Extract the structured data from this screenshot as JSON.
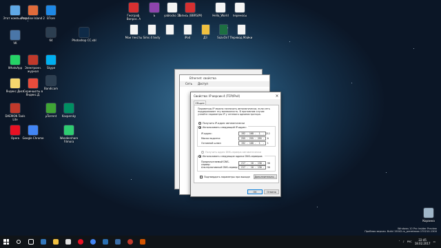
{
  "colors": {
    "accent": "#0078d7",
    "taskbar": "#101418"
  },
  "desktop_icons": [
    {
      "id": "this-pc",
      "label": "Этот компьютер",
      "icon": "computer-icon",
      "color": "#5fa8e6"
    },
    {
      "id": "paradise-island",
      "label": "Paradise Island 2",
      "icon": "game-icon",
      "color": "#e06b3b"
    },
    {
      "id": "bitrix",
      "label": "B7ore",
      "icon": "app-icon",
      "color": "#1e88e5"
    },
    {
      "id": "vk",
      "label": "VK",
      "icon": "vk-icon",
      "color": "#4a76a8"
    },
    {
      "id": "app64",
      "label": "64",
      "icon": "app-64-icon",
      "color": "#2c3e50"
    },
    {
      "id": "photoshop",
      "label": "Photoshop CC.xbl",
      "icon": "photoshop-icon",
      "color": "#0e2a47"
    },
    {
      "id": "whatsapp",
      "label": "WhatsApp",
      "icon": "whatsapp-icon",
      "color": "#25d366"
    },
    {
      "id": "electronic-journal",
      "label": "Электронн. журнал",
      "icon": "journal-icon",
      "color": "#c0392b"
    },
    {
      "id": "skype",
      "label": "Skype",
      "icon": "skype-icon",
      "color": "#00aff0"
    },
    {
      "id": "yandex-disk",
      "label": "Яндекс.Диск",
      "icon": "yandex-disk-icon",
      "color": "#f5d76e"
    },
    {
      "id": "screenshots",
      "label": "Скриншоты в Яндекс.Д.",
      "icon": "screenshots-icon",
      "color": "#e74c3c"
    },
    {
      "id": "bandicam",
      "label": "Bandicam",
      "icon": "bandicam-icon",
      "color": "#2c3e50"
    },
    {
      "id": "daemon",
      "label": "DAEMON Tools Lite",
      "icon": "daemon-tools-icon",
      "color": "#c0392b"
    },
    {
      "id": "utorrent",
      "label": "µTorrent",
      "icon": "utorrent-icon",
      "color": "#3fa535"
    },
    {
      "id": "kaspersky",
      "label": "Kaspersky",
      "icon": "kaspersky-icon",
      "color": "#008f62"
    },
    {
      "id": "opera",
      "label": "Opera",
      "icon": "opera-icon",
      "color": "#e81123"
    },
    {
      "id": "chrome",
      "label": "Google Chrome",
      "icon": "chrome-icon",
      "color": "#4285f4"
    },
    {
      "id": "wondershare",
      "label": "Wondershare Filmora",
      "icon": "filmora-icon",
      "color": "#2ecc71"
    }
  ],
  "top_icons": [
    {
      "id": "georg",
      "label": "Географ. Вопрос. А",
      "icon": "file-red-icon",
      "color": "#d63031"
    },
    {
      "id": "bk",
      "label": "Ь",
      "icon": "app-icon",
      "color": "#8e44ad"
    },
    {
      "id": "yabloko",
      "label": "yablocko 16",
      "icon": "file-icon",
      "color": "#f4f4f4"
    },
    {
      "id": "zapis",
      "label": "Запись (BBRS/M)",
      "icon": "file-red-icon",
      "color": "#d63031"
    },
    {
      "id": "hello",
      "label": "Hello_World",
      "icon": "file-icon",
      "color": "#f4f4f4"
    },
    {
      "id": "perenos",
      "label": "переносы",
      "icon": "file-icon",
      "color": "#f4f4f4"
    }
  ],
  "top_icons_row2": [
    {
      "id": "moi-teksty",
      "label": "Мои тексты",
      "icon": "file-icon"
    },
    {
      "id": "sims",
      "label": "Sims 4 texty",
      "icon": "file-icon"
    },
    {
      "id": "f1",
      "label": "",
      "icon": "file-icon"
    },
    {
      "id": "ipod",
      "label": "iPod",
      "icon": "file-icon"
    },
    {
      "id": "dz",
      "label": "ДЗ",
      "icon": "folder-icon"
    },
    {
      "id": "sozvon",
      "label": "SozvOn7",
      "icon": "excel-icon"
    },
    {
      "id": "perevod",
      "label": "Перевод Майки",
      "icon": "file-icon"
    }
  ],
  "dialog_back": {
    "title": "Ethernet: свойства",
    "tab_net": "Сеть",
    "tab_access": "Доступ"
  },
  "dialog": {
    "title": "Свойства: IP версии 4 (TCP/IPv4)",
    "close": "×",
    "tab": "Общие",
    "description": "Параметры IP можно назначать автоматически, если сеть поддерживает эту возможность. В противном случае узнайте параметры IP у сетевого администратора.",
    "radio_auto_ip": "Получить IP-адрес автоматически",
    "radio_manual_ip": "Использовать следующий IP-адрес:",
    "ip_label": "IP-адрес:",
    "ip_value": "192 . 168 .  1  . 212",
    "mask_label": "Маска подсети:",
    "mask_value": "255 . 255 . 255 .  0",
    "gateway_label": "Основной шлюз:",
    "gateway_value": "192 . 168 .  1  .  1",
    "radio_auto_dns": "Получить адрес DNS-сервера автоматически",
    "radio_manual_dns": "Использовать следующие адреса DNS-серверов:",
    "dns1_label": "Предпочитаемый DNS-сервер:",
    "dns1_value": "217 .  10 . 130 .  30",
    "dns2_label": "Альтернативный DNS-сервер:",
    "dns2_value": "217 .  10 . 130 .  30",
    "validate_label": "Подтвердить параметры при выходе",
    "advanced_button": "Дополнительно...",
    "ok_button": "OK",
    "cancel_button": "Отмена"
  },
  "taskbar": {
    "tray_lang": "РУС",
    "clock_time": "22:45",
    "clock_date": "18.02.2017"
  },
  "watermark": {
    "line1": "Windows 10 Pro Insider Preview",
    "line2": "Пробная версия. Build 15042.rs_prerelease.170210-1300"
  },
  "recycle_bin": {
    "label": "Корзина",
    "icon": "recycle-bin-icon"
  }
}
